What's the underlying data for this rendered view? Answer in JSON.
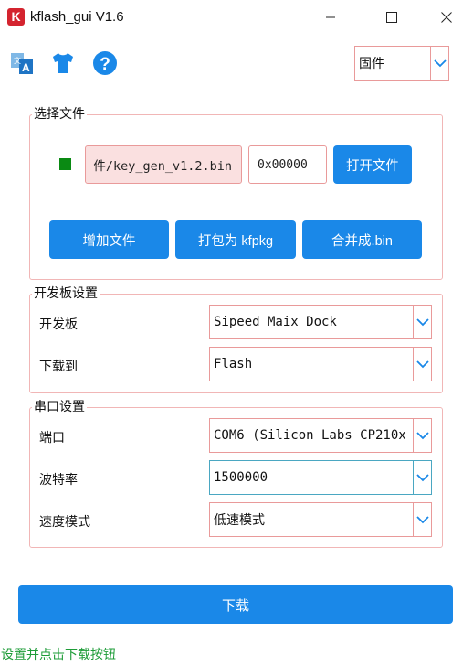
{
  "window": {
    "logo_letter": "K",
    "title": "kflash_gui V1.6"
  },
  "toolbar": {
    "icons": [
      "translate-icon",
      "tshirt-icon",
      "help-icon"
    ],
    "mode_select": {
      "value": "固件"
    }
  },
  "file_group": {
    "title": "选择文件",
    "status_color": "#0a8a13",
    "file_path": "件/key_gen_v1.2.bin",
    "address": "0x00000",
    "open_button": "打开文件",
    "add_button": "增加文件",
    "pack_button": "打包为 kfpkg",
    "merge_button": "合并成.bin"
  },
  "board_group": {
    "title": "开发板设置",
    "board_label": "开发板",
    "board_value": "Sipeed Maix Dock",
    "target_label": "下载到",
    "target_value": "Flash"
  },
  "serial_group": {
    "title": "串口设置",
    "port_label": "端口",
    "port_value": "COM6 (Silicon Labs CP210x",
    "baud_label": "波特率",
    "baud_value": "1500000",
    "speed_label": "速度模式",
    "speed_value": "低速模式"
  },
  "download_button": "下载",
  "status_text": "设置并点击下载按钮",
  "colors": {
    "accent_blue": "#1a88e8",
    "border_pink": "#e99a9a",
    "status_green": "#1e9c38"
  }
}
